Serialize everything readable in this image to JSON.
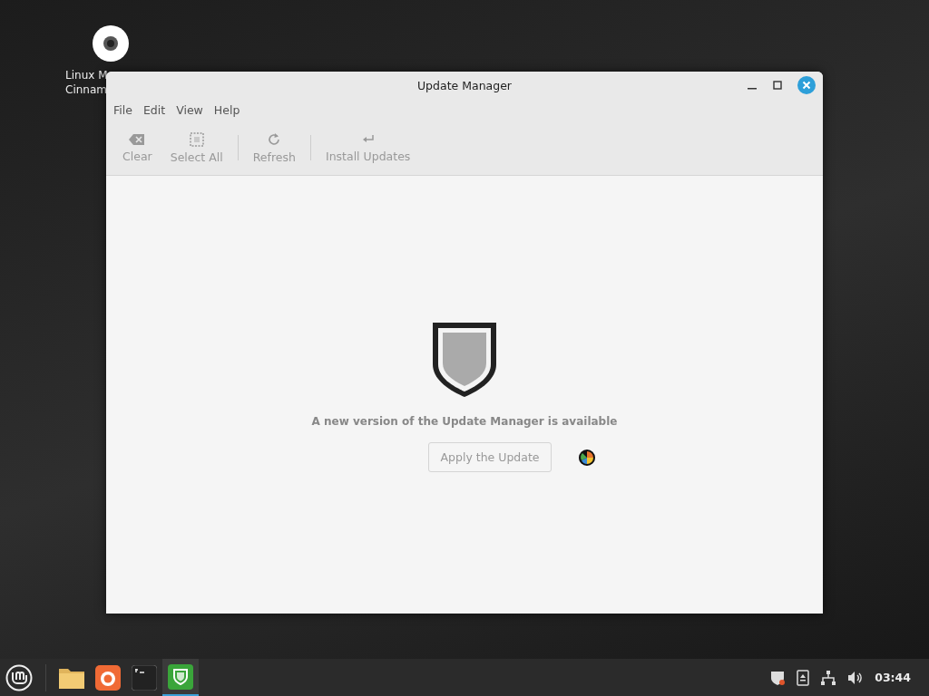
{
  "desktop_icons": [
    {
      "lines": [
        "Linux M",
        "Cinnam"
      ]
    }
  ],
  "window": {
    "title": "Update Manager",
    "menu": [
      "File",
      "Edit",
      "View",
      "Help"
    ],
    "toolbar": [
      {
        "kind": "clear",
        "label": "Clear",
        "disabled": true,
        "separator_after": false
      },
      {
        "kind": "select",
        "label": "Select All",
        "disabled": true,
        "separator_after": true
      },
      {
        "kind": "refresh",
        "label": "Refresh",
        "disabled": true,
        "separator_after": true
      },
      {
        "kind": "install",
        "label": "Install Updates",
        "disabled": true,
        "separator_after": false
      }
    ],
    "message": "A new version of the Update Manager is available",
    "apply_button": {
      "label": "Apply the Update",
      "disabled": true
    }
  },
  "taskbar": {
    "apps": [
      {
        "kind": "files",
        "selected": false
      },
      {
        "kind": "browser",
        "selected": false
      },
      {
        "kind": "terminal",
        "selected": false
      },
      {
        "kind": "update",
        "selected": true
      }
    ],
    "clock": "03:44"
  }
}
